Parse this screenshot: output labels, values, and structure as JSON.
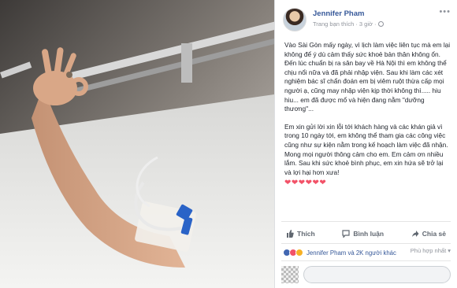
{
  "post": {
    "author": "Jennifer Pham",
    "meta": "Trang bạn thích · 3 giờ · ",
    "paragraphs": [
      "Vào Sài Gòn mấy ngày, vì lịch làm việc liên tục mà em lại không để ý dù cảm thấy sức khoẻ bản thân không ổn. Đến lúc chuẩn bị ra sân bay về Hà Nội thì em không thể chịu nổi nữa và đã phải nhập viện. Sau khi làm các xét nghiệm bác sĩ chẩn đoán em bị viêm ruột thừa cấp mọi người ạ, cũng may nhập viện kịp thời không thì..... hiu hiu... em đã được mổ và hiện đang nằm \"dưỡng thương\"...",
      "Em xin gửi lời xin lỗi tới khách hàng và các khán giả vì trong 10 ngày tới, em không thể tham gia các công việc cũng như sự kiện nằm trong kế hoạch làm việc đã nhận. Mong mọi người thông cảm cho em. Em cảm ơn nhiều lắm. Sau khi sức khoẻ bình phục, em xin hứa sẽ trở lại và lợi hại hơn xưa!"
    ],
    "hearts": "❤❤❤❤❤❤"
  },
  "actions": {
    "like": "Thích",
    "comment": "Bình luận",
    "share": "Chia sẻ"
  },
  "reactions": {
    "names": "Jennifer Pham và 2K người khác",
    "sort": "Phù hợp nhất ▾"
  },
  "colors": {
    "link": "#365899",
    "secondary": "#90949c",
    "heart": "#f25268",
    "like_blue": "#4267b2"
  },
  "icons": [
    "globe-icon",
    "more-icon",
    "like-icon",
    "comment-icon",
    "share-icon"
  ]
}
